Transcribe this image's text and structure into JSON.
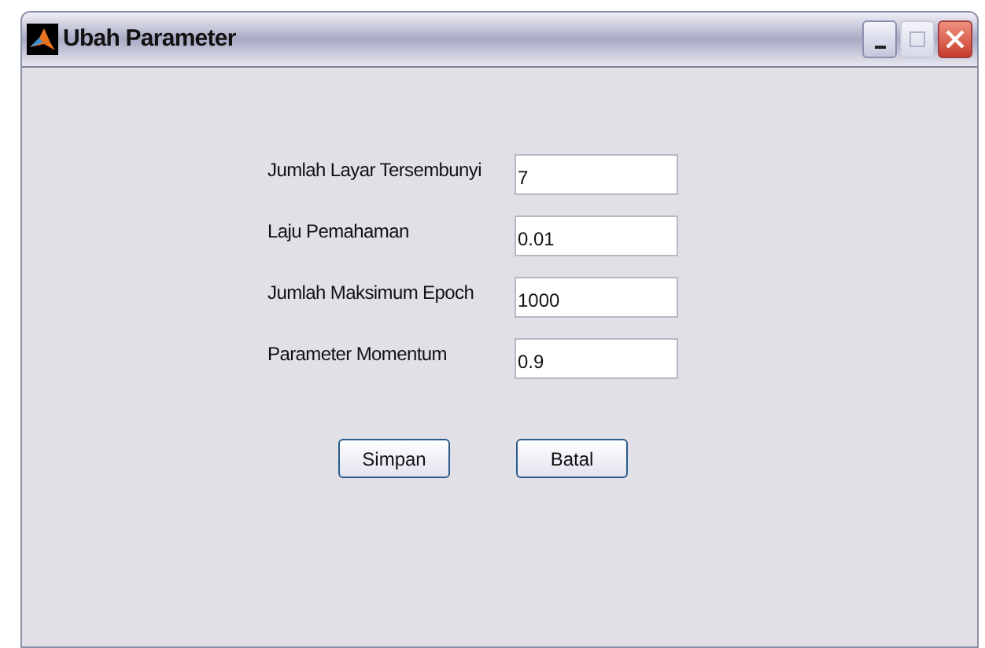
{
  "window": {
    "title": "Ubah Parameter"
  },
  "fields": [
    {
      "label": "Jumlah Layar Tersembunyi",
      "value": "7"
    },
    {
      "label": "Laju Pemahaman",
      "value": "0.01"
    },
    {
      "label": "Jumlah Maksimum Epoch",
      "value": "1000"
    },
    {
      "label": "Parameter Momentum",
      "value": "0.9"
    }
  ],
  "buttons": [
    "Simpan",
    "Batal"
  ]
}
